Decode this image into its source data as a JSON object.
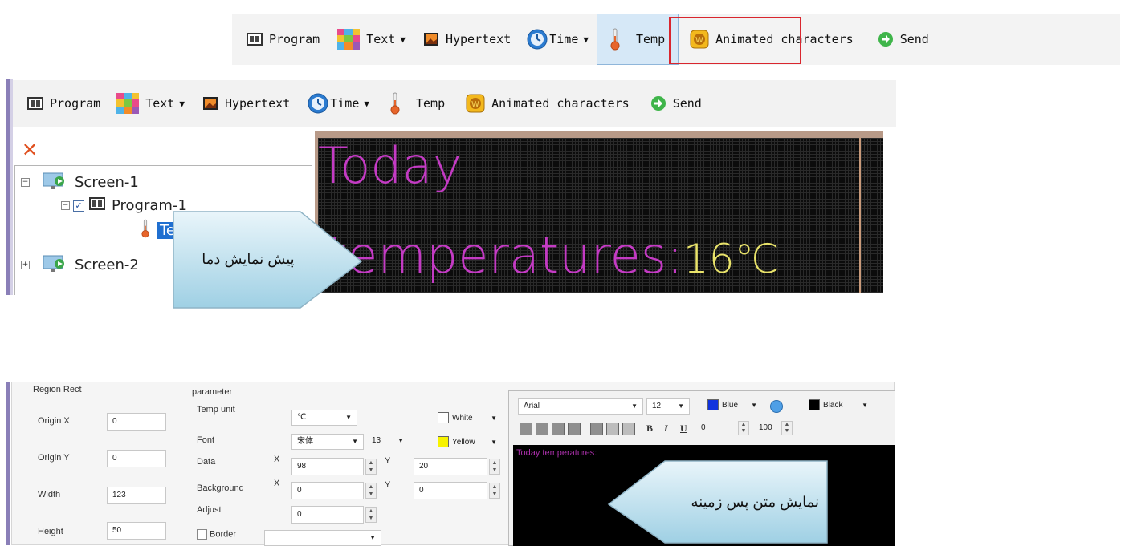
{
  "toolbar_top": {
    "items": [
      {
        "label": "Program",
        "icon": "program-icon"
      },
      {
        "label": "Text",
        "icon": "text-icon",
        "dropdown": true
      },
      {
        "label": "Hypertext",
        "icon": "hypertext-icon"
      },
      {
        "label": "Time",
        "icon": "time-icon",
        "dropdown": true
      },
      {
        "label": "Temp",
        "icon": "temp-icon",
        "highlighted": true
      },
      {
        "label": "Animated characters",
        "icon": "animated-icon"
      },
      {
        "label": "Send",
        "icon": "send-icon"
      }
    ]
  },
  "toolbar_mid": {
    "items": [
      {
        "label": "Program"
      },
      {
        "label": "Text"
      },
      {
        "label": "Hypertext"
      },
      {
        "label": "Time"
      },
      {
        "label": "Temp"
      },
      {
        "label": "Animated characters"
      },
      {
        "label": "Send"
      }
    ]
  },
  "tree": {
    "screen1": "Screen-1",
    "program1": "Program-1",
    "temp_item": "Te",
    "screen2": "Screen-2"
  },
  "preview": {
    "line1": "Today",
    "line2": "temperatures:",
    "value": "16",
    "unit": "℃",
    "text_color": "#c43bc4",
    "value_color": "#e9e36a"
  },
  "callouts": {
    "preview_label": "پیش نمایش دما",
    "background_text_label": "نمایش متن پس زمینه"
  },
  "settings": {
    "region_title": "Region Rect",
    "origin_x_label": "Origin X",
    "origin_x": "0",
    "origin_y_label": "Origin Y",
    "origin_y": "0",
    "width_label": "Width",
    "width": "123",
    "height_label": "Height",
    "height": "50",
    "param_title": "parameter",
    "temp_unit_label": "Temp unit",
    "temp_unit": "℃",
    "font_label": "Font",
    "font": "宋体",
    "font_size": "13",
    "data_label": "Data",
    "data_x_label": "X",
    "data_x": "98",
    "data_y_label": "Y",
    "data_y": "20",
    "background_label": "Background",
    "bg_x_label": "X",
    "bg_x": "0",
    "bg_y_label": "Y",
    "bg_y": "0",
    "adjust_label": "Adjust",
    "adjust": "0",
    "border_label": "Border",
    "color1": "White",
    "color2": "Yellow",
    "editor_font": "Arial",
    "editor_size": "12",
    "editor_fg": "Blue",
    "editor_bg": "Black",
    "spacing": "0",
    "scale": "100",
    "editor_text": "Today temperatures:"
  }
}
